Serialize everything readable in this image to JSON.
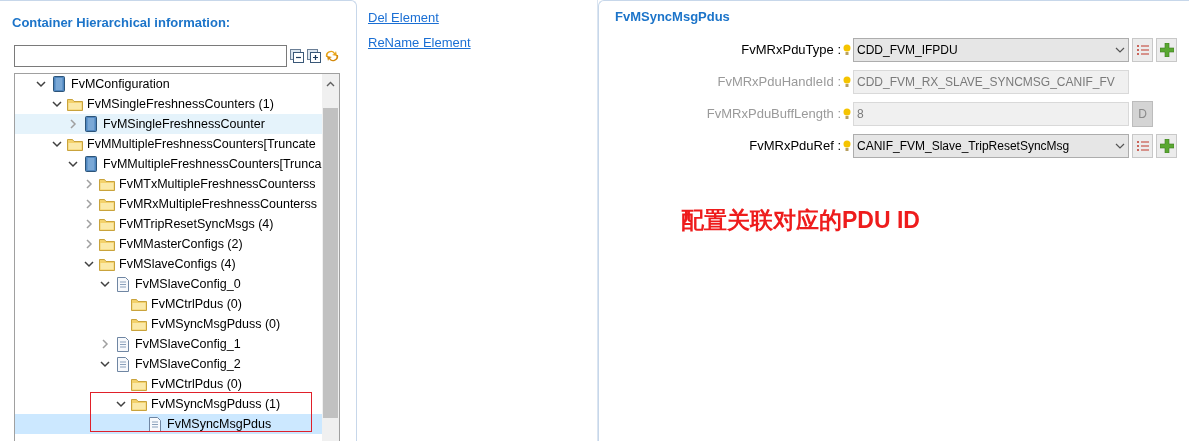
{
  "left_panel": {
    "title": "Container Hierarchical information:"
  },
  "tree": [
    {
      "label": "FvMConfiguration",
      "kind": "module",
      "expanded": true,
      "selected": false,
      "hovered": false,
      "children": [
        {
          "label": "FvMSingleFreshnessCounters (1)",
          "kind": "folder",
          "expanded": true,
          "selected": false,
          "hovered": false,
          "children": [
            {
              "label": "FvMSingleFreshnessCounter",
              "kind": "module",
              "expanded": false,
              "selected": false,
              "hovered": true
            }
          ]
        },
        {
          "label": "FvMMultipleFreshnessCounters[Truncate",
          "kind": "folder",
          "expanded": true,
          "selected": false,
          "hovered": false,
          "children": [
            {
              "label": "FvMMultipleFreshnessCounters[Trunca",
              "kind": "module",
              "expanded": true,
              "selected": false,
              "hovered": false,
              "children": [
                {
                  "label": "FvMTxMultipleFreshnessCounterss",
                  "kind": "folder",
                  "expanded": false,
                  "selected": false,
                  "hovered": false
                },
                {
                  "label": "FvMRxMultipleFreshnessCounterss",
                  "kind": "folder",
                  "expanded": false,
                  "selected": false,
                  "hovered": false
                },
                {
                  "label": "FvMTripResetSyncMsgs (4)",
                  "kind": "folder",
                  "expanded": false,
                  "selected": false,
                  "hovered": false
                },
                {
                  "label": "FvMMasterConfigs (2)",
                  "kind": "folder",
                  "expanded": false,
                  "selected": false,
                  "hovered": false
                },
                {
                  "label": "FvMSlaveConfigs (4)",
                  "kind": "folder",
                  "expanded": true,
                  "selected": false,
                  "hovered": false,
                  "children": [
                    {
                      "label": "FvMSlaveConfig_0",
                      "kind": "document",
                      "expanded": true,
                      "selected": false,
                      "hovered": false,
                      "children": [
                        {
                          "label": "FvMCtrlPdus (0)",
                          "kind": "leaf_folder",
                          "selected": false,
                          "hovered": false
                        },
                        {
                          "label": "FvMSyncMsgPduss (0)",
                          "kind": "leaf_folder",
                          "selected": false,
                          "hovered": false
                        }
                      ]
                    },
                    {
                      "label": "FvMSlaveConfig_1",
                      "kind": "document",
                      "expanded": false,
                      "selected": false,
                      "hovered": false
                    },
                    {
                      "label": "FvMSlaveConfig_2",
                      "kind": "document",
                      "expanded": true,
                      "selected": false,
                      "hovered": false,
                      "children": [
                        {
                          "label": "FvMCtrlPdus (0)",
                          "kind": "leaf_folder",
                          "selected": false,
                          "hovered": false
                        },
                        {
                          "label": "FvMSyncMsgPduss (1)",
                          "kind": "folder",
                          "expanded": true,
                          "selected": false,
                          "hovered": false,
                          "children": [
                            {
                              "label": "FvMSyncMsgPdus",
                              "kind": "leaf_document",
                              "selected": true,
                              "hovered": false
                            }
                          ]
                        }
                      ]
                    }
                  ]
                }
              ]
            }
          ]
        }
      ]
    }
  ],
  "actions": [
    "Del Element",
    "ReName Element"
  ],
  "editor": {
    "title": "FvMSyncMsgPdus",
    "fields": [
      {
        "label": "FvMRxPduType :",
        "kind": "dropdown",
        "value": "CDD_FVM_IFPDU",
        "disabled": false
      },
      {
        "label": "FvMRxPduHandleId :",
        "kind": "text",
        "value": "CDD_FVM_RX_SLAVE_SYNCMSG_CANIF_FV",
        "disabled": true
      },
      {
        "label": "FvMRxPduBuffLength :",
        "kind": "default",
        "value": "8",
        "disabled": true,
        "default_button": "D"
      },
      {
        "label": "FvMRxPduRef :",
        "kind": "dropdown",
        "value": "CANIF_FVM_Slave_TripResetSyncMsg",
        "disabled": false
      }
    ]
  },
  "annotation": {
    "text": "配置关联对应的PDU ID"
  }
}
